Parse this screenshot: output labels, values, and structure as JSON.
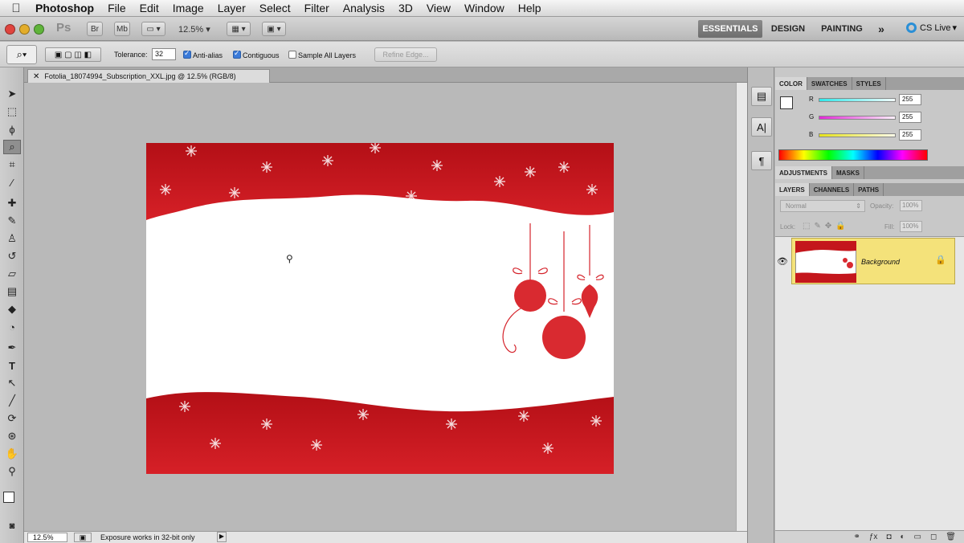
{
  "menubar": {
    "app_name": "Photoshop",
    "items": [
      "File",
      "Edit",
      "Image",
      "Layer",
      "Select",
      "Filter",
      "Analysis",
      "3D",
      "View",
      "Window",
      "Help"
    ]
  },
  "appbar": {
    "ps_logo": "Ps",
    "zoom": "12.5%",
    "workspaces": [
      "ESSENTIALS",
      "DESIGN",
      "PAINTING"
    ],
    "more": "»",
    "cs_live": "CS Live"
  },
  "options": {
    "tolerance_label": "Tolerance:",
    "tolerance_value": "32",
    "anti_alias": "Anti-alias",
    "contiguous": "Contiguous",
    "sample_all_layers": "Sample All Layers",
    "refine_edge": "Refine Edge..."
  },
  "document": {
    "tab_title": "Fotolia_18074994_Subscription_XXL.jpg @ 12.5% (RGB/8)"
  },
  "status": {
    "zoom": "12.5%",
    "info": "Exposure works in 32-bit only"
  },
  "color_panel": {
    "tabs": [
      "COLOR",
      "SWATCHES",
      "STYLES"
    ],
    "channels": [
      {
        "label": "R",
        "value": "255"
      },
      {
        "label": "G",
        "value": "255"
      },
      {
        "label": "B",
        "value": "255"
      }
    ]
  },
  "adjustments_panel": {
    "tabs": [
      "ADJUSTMENTS",
      "MASKS"
    ]
  },
  "layers_panel": {
    "tabs": [
      "LAYERS",
      "CHANNELS",
      "PATHS"
    ],
    "blend_mode": "Normal",
    "opacity_label": "Opacity:",
    "opacity_value": "100%",
    "lock_label": "Lock:",
    "fill_label": "Fill:",
    "fill_value": "100%",
    "layer_name": "Background"
  },
  "colors": {
    "accent_red": "#c4161c",
    "selected_layer": "#f4e27a"
  }
}
